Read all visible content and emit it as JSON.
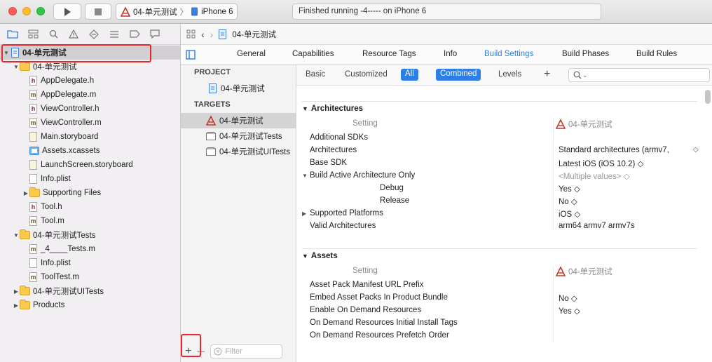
{
  "toolbar": {
    "scheme_name": "04-单元测试",
    "device_name": "iPhone 6",
    "status_text": "Finished running -4----- on iPhone 6"
  },
  "navigator": {
    "items": [
      {
        "label": "04-单元测试",
        "level": 0,
        "type": "project",
        "disclosure": "▼"
      },
      {
        "label": "04-单元测试",
        "level": 1,
        "type": "folder",
        "disclosure": "▼"
      },
      {
        "label": "AppDelegate.h",
        "level": 2,
        "type": "h"
      },
      {
        "label": "AppDelegate.m",
        "level": 2,
        "type": "m"
      },
      {
        "label": "ViewController.h",
        "level": 2,
        "type": "h"
      },
      {
        "label": "ViewController.m",
        "level": 2,
        "type": "m"
      },
      {
        "label": "Main.storyboard",
        "level": 2,
        "type": "storyboard"
      },
      {
        "label": "Assets.xcassets",
        "level": 2,
        "type": "assets"
      },
      {
        "label": "LaunchScreen.storyboard",
        "level": 2,
        "type": "storyboard"
      },
      {
        "label": "Info.plist",
        "level": 2,
        "type": "plist"
      },
      {
        "label": "Supporting Files",
        "level": 2,
        "type": "folder",
        "disclosure": "▶"
      },
      {
        "label": "Tool.h",
        "level": 2,
        "type": "h"
      },
      {
        "label": "Tool.m",
        "level": 2,
        "type": "m"
      },
      {
        "label": "04-单元测试Tests",
        "level": 1,
        "type": "folder",
        "disclosure": "▼"
      },
      {
        "label": "_4____Tests.m",
        "level": 2,
        "type": "m"
      },
      {
        "label": "Info.plist",
        "level": 2,
        "type": "plist"
      },
      {
        "label": "ToolTest.m",
        "level": 2,
        "type": "m"
      },
      {
        "label": "04-单元测试UITests",
        "level": 1,
        "type": "folder",
        "disclosure": "▶"
      },
      {
        "label": "Products",
        "level": 1,
        "type": "folder",
        "disclosure": "▶"
      }
    ]
  },
  "editor": {
    "breadcrumb": "04-单元测试",
    "tabs": [
      "General",
      "Capabilities",
      "Resource Tags",
      "Info",
      "Build Settings",
      "Build Phases",
      "Build Rules"
    ],
    "active_tab": "Build Settings",
    "project_header": "PROJECT",
    "project_item": "04-单元测试",
    "targets_header": "TARGETS",
    "targets": [
      "04-单元测试",
      "04-单元测试Tests",
      "04-单元测试UITests"
    ],
    "filter_placeholder": "Filter",
    "add_symbol": "+",
    "remove_symbol": "—"
  },
  "settings": {
    "filters": {
      "basic": "Basic",
      "customized": "Customized",
      "all": "All",
      "combined": "Combined",
      "levels": "Levels",
      "add": "+"
    },
    "search_icon_text": "Q~",
    "architectures": {
      "title": "Architectures",
      "col_setting": "Setting",
      "col_target": "04-单元测试",
      "rows": [
        {
          "label": "Additional SDKs",
          "value": ""
        },
        {
          "label": "Architectures",
          "value": "Standard architectures (armv7,"
        },
        {
          "label": "Base SDK",
          "value": "Latest iOS (iOS 10.2) ◇"
        },
        {
          "label": "Build Active Architecture Only",
          "value": "<Multiple values> ◇"
        },
        {
          "label": "Debug",
          "value": "Yes ◇"
        },
        {
          "label": "Release",
          "value": "No ◇"
        },
        {
          "label": "Supported Platforms",
          "value": "iOS ◇"
        },
        {
          "label": "Valid Architectures",
          "value": "arm64 armv7 armv7s"
        }
      ]
    },
    "assets": {
      "title": "Assets",
      "col_setting": "Setting",
      "col_target": "04-单元测试",
      "rows": [
        {
          "label": "Asset Pack Manifest URL Prefix",
          "value": ""
        },
        {
          "label": "Embed Asset Packs In Product Bundle",
          "value": "No ◇"
        },
        {
          "label": "Enable On Demand Resources",
          "value": "Yes ◇"
        },
        {
          "label": "On Demand Resources Initial Install Tags",
          "value": ""
        },
        {
          "label": "On Demand Resources Prefetch Order",
          "value": ""
        }
      ]
    }
  },
  "colors": {
    "accent": "#2a7fe6",
    "highlight_outline": "#e8262c"
  }
}
